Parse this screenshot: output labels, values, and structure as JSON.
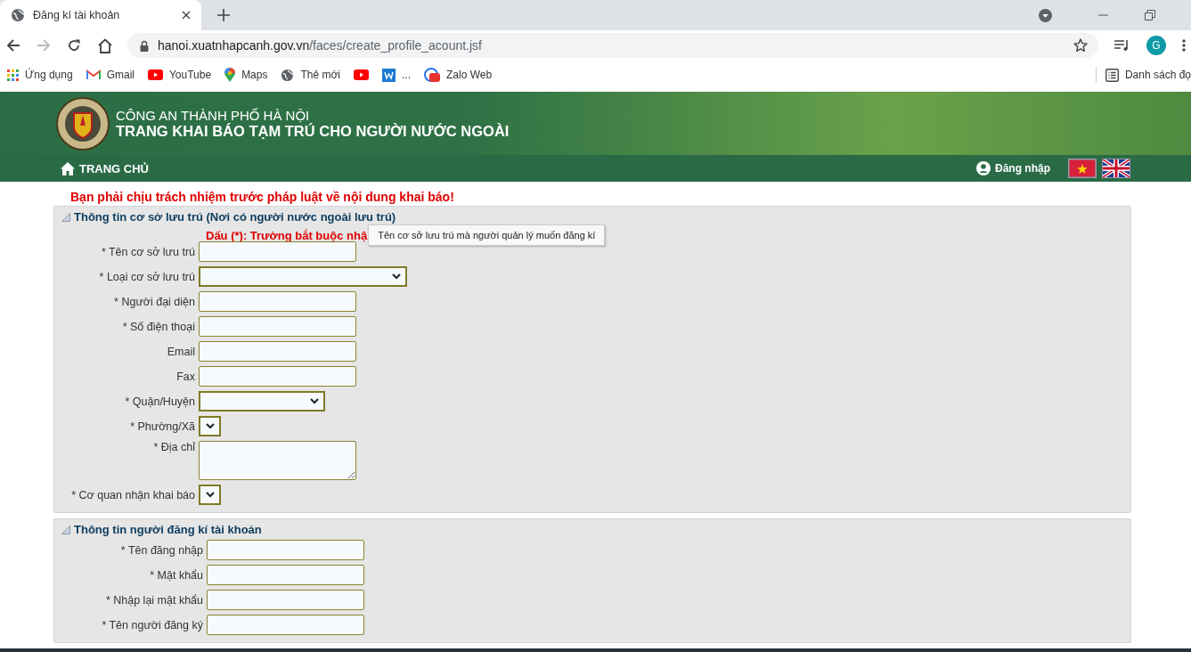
{
  "browser": {
    "tab_title": "Đăng kí tài khoản",
    "url_host": "hanoi.xuatnhapcanh.gov.vn",
    "url_path": "/faces/create_profile_acount.jsf",
    "profile_initial": "G",
    "bookmarks": [
      {
        "kind": "apps",
        "label": "Ứng dụng"
      },
      {
        "kind": "gmail",
        "label": "Gmail"
      },
      {
        "kind": "youtube",
        "label": "YouTube"
      },
      {
        "kind": "maps",
        "label": "Maps"
      },
      {
        "kind": "globe",
        "label": "Thẻ mới"
      },
      {
        "kind": "youtube"
      },
      {
        "kind": "word",
        "label": "..."
      },
      {
        "kind": "zalo",
        "label": "Zalo Web"
      }
    ],
    "reading_list": "Danh sách đọ"
  },
  "header": {
    "agency": "CÔNG AN THÀNH PHỐ HÀ NỘI",
    "title": "TRANG KHAI BÁO TẠM TRÚ CHO NGƯỜI NƯỚC NGOÀI"
  },
  "nav": {
    "home": "TRANG CHỦ",
    "login": "Đăng nhập"
  },
  "warning": "Bạn phải chịu trách nhiệm trước pháp luật về nội dung khai báo!",
  "sections": [
    {
      "title": "Thông tin cơ sở lưu trú (Nơi có người nước ngoài lưu trú)",
      "note": "Dấu (*): Trường bắt buộc nhậ",
      "tooltip": "Tên cơ sở lưu trú mà người quản lý muốn đăng kí",
      "fields": [
        {
          "kind": "text",
          "label": "* Tên cơ sở lưu trú"
        },
        {
          "kind": "select_wide",
          "label": "* Loại cơ sở lưu trú"
        },
        {
          "kind": "text",
          "label": "* Người đại diện"
        },
        {
          "kind": "text",
          "label": "* Số điện thoại"
        },
        {
          "kind": "text",
          "label": "Email"
        },
        {
          "kind": "text",
          "label": "Fax"
        },
        {
          "kind": "select_medium",
          "label": "* Quận/Huyện"
        },
        {
          "kind": "select_narrow",
          "label": "* Phường/Xã"
        },
        {
          "kind": "textarea",
          "label": "* Địa chỉ"
        },
        {
          "kind": "select_narrow",
          "label": "* Cơ quan nhận khai báo"
        }
      ]
    },
    {
      "title": "Thông tin người đăng kí tài khoản",
      "fields": [
        {
          "kind": "text",
          "label": "* Tên đăng nhập"
        },
        {
          "kind": "text",
          "label": "* Mật khẩu"
        },
        {
          "kind": "text",
          "label": "* Nhập lại mật khẩu"
        },
        {
          "kind": "text",
          "label": "* Tên người đăng ký"
        }
      ]
    }
  ]
}
